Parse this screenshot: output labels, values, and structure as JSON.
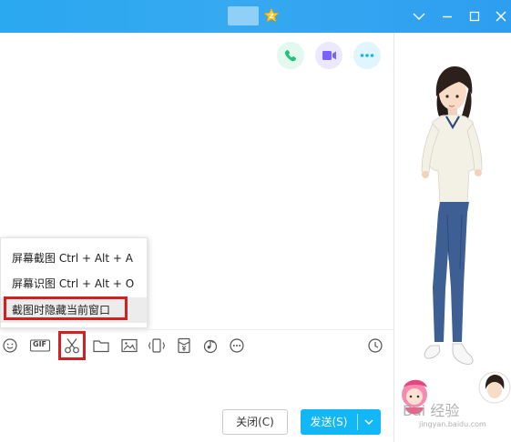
{
  "titlebar": {
    "badge_icon": "vip-star-icon",
    "controls": [
      "chevron-down-icon",
      "minimize-icon",
      "maximize-icon",
      "close-icon"
    ]
  },
  "call_actions": [
    {
      "icon": "phone-icon",
      "color": "#21c27a"
    },
    {
      "icon": "video-icon",
      "color": "#7b61ff"
    },
    {
      "icon": "more-icon",
      "color": "#12b7f5"
    }
  ],
  "screenshot_menu": {
    "items": [
      {
        "label": "屏幕截图 Ctrl + Alt + A"
      },
      {
        "label": "屏幕识图 Ctrl + Alt + O"
      },
      {
        "label": "截图时隐藏当前窗口"
      }
    ]
  },
  "toolbar": {
    "tools": [
      "emoji-icon",
      "gif-icon",
      "scissors-icon",
      "folder-icon",
      "image-icon",
      "shake-icon",
      "red-packet-icon",
      "music-icon",
      "more-icon",
      "history-icon"
    ],
    "gif_label": "GIF"
  },
  "buttons": {
    "close_label": "关闭(C)",
    "send_label": "发送(S)"
  },
  "watermark": {
    "main": "Bai 经验",
    "sub": "jingyan.baidu.com"
  },
  "colors": {
    "title_bar": "#2aa8f0",
    "send_button": "#12b7f5",
    "highlight": "#d21f1f"
  }
}
